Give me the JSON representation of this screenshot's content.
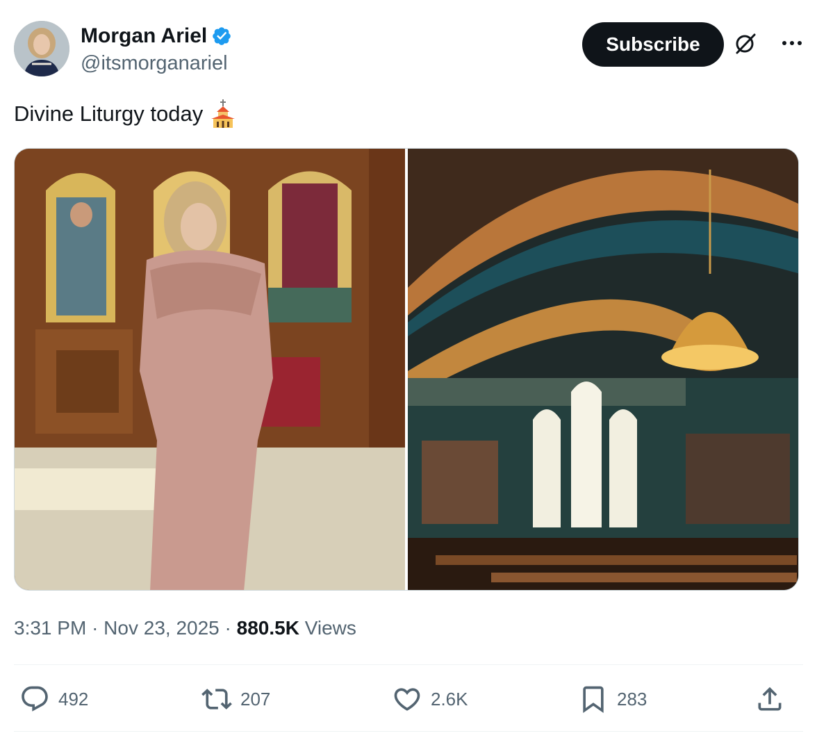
{
  "author": {
    "display_name": "Morgan Ariel",
    "handle": "@itsmorganariel",
    "verified": true
  },
  "header": {
    "subscribe_label": "Subscribe"
  },
  "tweet": {
    "text": "Divine Liturgy today",
    "emoji": "church-emoji"
  },
  "meta": {
    "time": "3:31 PM",
    "separator": "·",
    "date": "Nov 23, 2025",
    "views_count": "880.5K",
    "views_label": "Views"
  },
  "actions": {
    "replies": "492",
    "reposts": "207",
    "likes": "2.6K",
    "bookmarks": "283"
  },
  "colors": {
    "text_primary": "#0f1419",
    "text_secondary": "#536471",
    "verified_blue": "#1d9bf0",
    "button_dark": "#0f1419",
    "border": "#cfd9de"
  },
  "icons": [
    "verified-badge-icon",
    "grok-icon",
    "more-icon",
    "reply-icon",
    "repost-icon",
    "like-icon",
    "bookmark-icon",
    "share-icon"
  ]
}
